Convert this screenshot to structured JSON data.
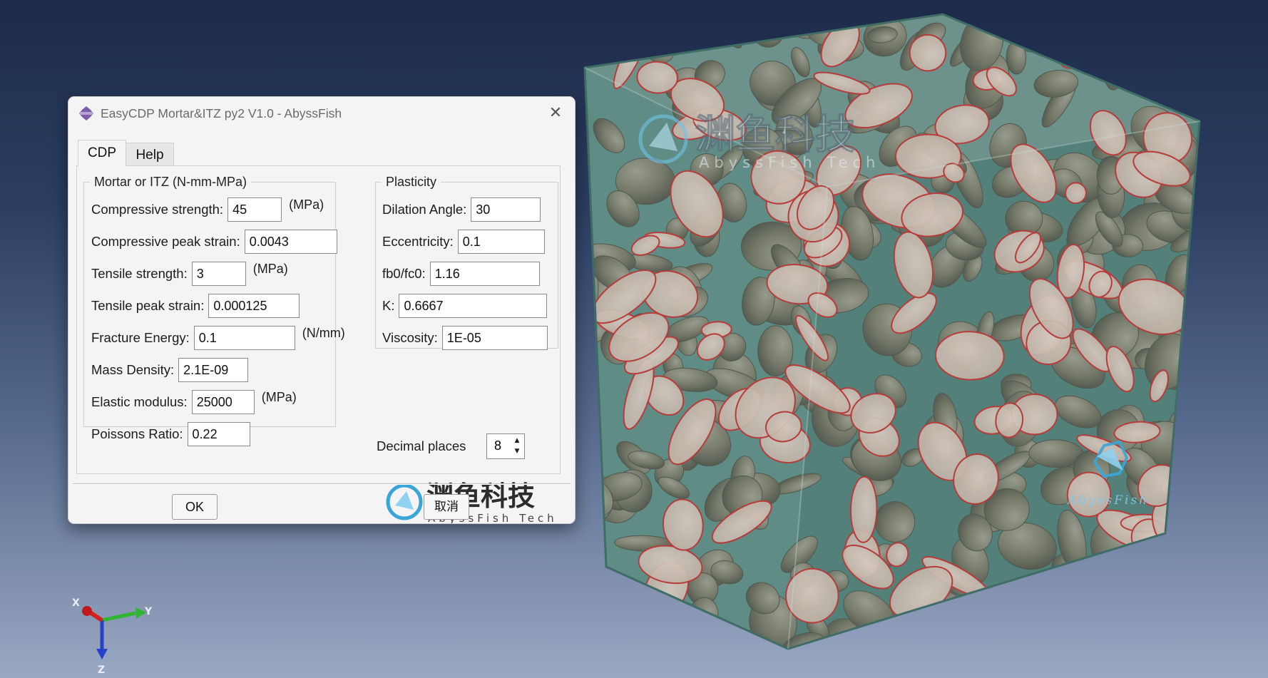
{
  "window": {
    "title": "EasyCDP Mortar&ITZ py2 V1.0 - AbyssFish",
    "close_glyph": "✕"
  },
  "tabs": [
    {
      "label": "CDP",
      "active": true
    },
    {
      "label": "Help",
      "active": false
    }
  ],
  "mortar_group": {
    "legend": "Mortar or ITZ (N-mm-MPa)",
    "fields": {
      "compressive_strength": {
        "label": "Compressive strength:",
        "value": "45",
        "unit": "(MPa)"
      },
      "compressive_peak_strain": {
        "label": "Compressive peak strain:",
        "value": "0.0043"
      },
      "tensile_strength": {
        "label": "Tensile strength:",
        "value": "3",
        "unit": "(MPa)"
      },
      "tensile_peak_strain": {
        "label": "Tensile peak strain:",
        "value": "0.000125"
      },
      "fracture_energy": {
        "label": "Fracture Energy:",
        "value": "0.1",
        "unit": "(N/mm)"
      },
      "mass_density": {
        "label": "Mass Density:",
        "value": "2.1E-09"
      },
      "elastic_modulus": {
        "label": "Elastic modulus:",
        "value": "25000",
        "unit": "(MPa)"
      },
      "poissons_ratio": {
        "label": "Poissons Ratio:",
        "value": "0.22"
      }
    }
  },
  "plasticity_group": {
    "legend": "Plasticity",
    "fields": {
      "dilation_angle": {
        "label": "Dilation Angle:",
        "value": "30"
      },
      "eccentricity": {
        "label": "Eccentricity:",
        "value": "0.1"
      },
      "fb0_fc0": {
        "label": "fb0/fc0:",
        "value": "1.16"
      },
      "k": {
        "label": "K:",
        "value": "0.6667"
      },
      "viscosity": {
        "label": "Viscosity:",
        "value": "1E-05"
      }
    }
  },
  "decimal_places": {
    "label": "Decimal places",
    "value": "8"
  },
  "buttons": {
    "ok": "OK",
    "cancel": "取消"
  },
  "watermark": {
    "cn": "渊鱼科技",
    "en": "AbyssFish Tech",
    "corner_en": "AbyssFish"
  },
  "axes": {
    "x": "X",
    "y": "Y",
    "z": "Z"
  },
  "colors": {
    "background_top": "#1d2b4a",
    "background_bottom": "#9aa8c2",
    "cube_mortar": "#5c8a82",
    "aggregate": "#807c6f",
    "aggregate_section": "#d8bfb3",
    "section_outline": "#c62828",
    "watermark_blue": "#3aa6d8"
  }
}
